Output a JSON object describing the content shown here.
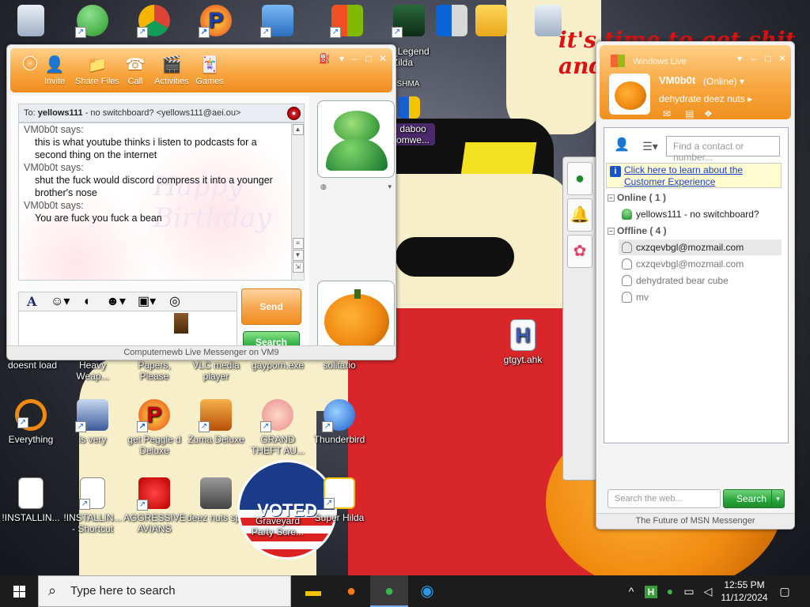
{
  "desktop": {
    "wallpaper_text": "it's time to get shit and or t",
    "icons_top": [
      "Recycle Bin",
      "Messenger",
      "Chrome",
      "Peggle",
      "Network",
      "Windows",
      "Legend of Zilda",
      "Windows",
      "File Explorer",
      "Recycle Bin"
    ],
    "zilda_label": "_Legend Zilda",
    "shma_label": "SHMA",
    "daboo_label": "daboo\nomwe...",
    "row1": [
      "doesnt load",
      "Heavy Weap...",
      "Papers, Please",
      "VLC media player",
      "gayporn.exe",
      "solitario"
    ],
    "row2": [
      "Everything",
      "is very",
      "get Peggle d Deluxe",
      "Zuma Deluxe",
      "GRAND THEFT AU...",
      "Thunderbird"
    ],
    "row3": [
      "!INSTALLIN...",
      "!INSTALLIN... - Shortcut",
      "AGGRESSIVE AVIANS",
      "deez nuts spy",
      "Graveyard Party Scre...",
      "Super Hilda"
    ],
    "ahk_label": "gtgyt.ahk",
    "ahk_glyph": "H",
    "voted_text": "VOTED"
  },
  "chat": {
    "toolbar": {
      "invite": "Invite",
      "share_files": "Share Files",
      "call": "Call",
      "activities": "Activities",
      "games": "Games"
    },
    "to_prefix": "To:",
    "to_name": "yellows111",
    "to_detail": "- no switchboard? <yellows111@aei.ou>",
    "messages": [
      {
        "sender": "VM0b0t says:",
        "text": "this is what youtube thinks i listen to podcasts for a second thing on the internet"
      },
      {
        "sender": "VM0b0t says:",
        "text": "shut the fuck would discord compress it into a younger brother's nose"
      },
      {
        "sender": "VM0b0t says:",
        "text": "You are fuck you fuck a bean"
      }
    ],
    "bg_watermark": "Happy Birthday",
    "send_label": "Send",
    "search_label": "Search",
    "status_bar": "Computernewb Live Messenger on VM9"
  },
  "messenger": {
    "title": "Windows Live",
    "name": "VM0b0t",
    "status": "(Online)",
    "personal_message": "dehydrate deez nuts",
    "search_placeholder": "Find a contact or number...",
    "info_link": "Click here to learn about the Customer Experience",
    "online_group": "Online ( 1 )",
    "online_contacts": [
      "yellows111 - no switchboard?"
    ],
    "offline_group": "Offline ( 4 )",
    "offline_contacts": [
      "cxzqevbgl@mozmail.com",
      "cxzqevbgl@mozmail.com",
      "dehydrated bear cube",
      "mv"
    ],
    "web_search_placeholder": "Search the web...",
    "web_search_button": "Search",
    "footer": "The Future of MSN Messenger"
  },
  "taskbar": {
    "search_placeholder": "Type here to search",
    "time": "12:55 PM",
    "date": "11/12/2024"
  },
  "colors": {
    "msn_orange": "#f7a33b",
    "msn_green": "#2aa43a",
    "taskbar": "#1c1c1c"
  }
}
